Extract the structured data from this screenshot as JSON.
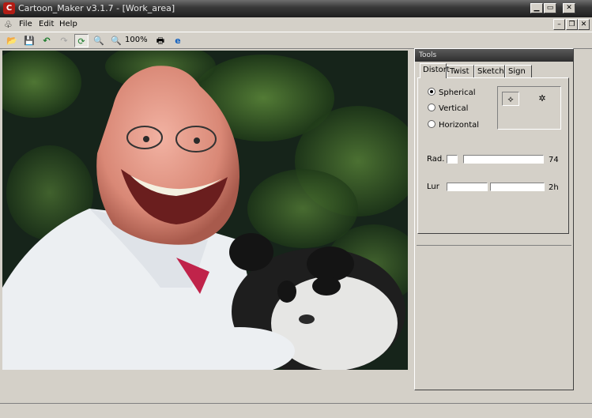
{
  "window": {
    "title": "Cartoon_Maker v3.1.7 - [Work_area]"
  },
  "menu": {
    "items": [
      "File",
      "Edit",
      "Help"
    ]
  },
  "toolbar": {
    "buttons": [
      "open-icon",
      "save-icon",
      "undo-icon",
      "redo-icon",
      "refresh-icon",
      "zoom-out-icon",
      "zoom-in-icon",
      "print-icon",
      "web-icon"
    ],
    "zoom": "100%"
  },
  "tools_panel": {
    "title": "Tools",
    "tabs": [
      "Distort",
      "Twist",
      "Sketch",
      "Sign"
    ],
    "active_tab": "Distort",
    "options": [
      {
        "label": "Spherical",
        "selected": true
      },
      {
        "label": "Vertical",
        "selected": false
      },
      {
        "label": "Horizontal",
        "selected": false
      }
    ],
    "sliders": [
      {
        "label": "Rad.",
        "value": "74"
      },
      {
        "label": "Lur",
        "value": "2h"
      }
    ]
  }
}
